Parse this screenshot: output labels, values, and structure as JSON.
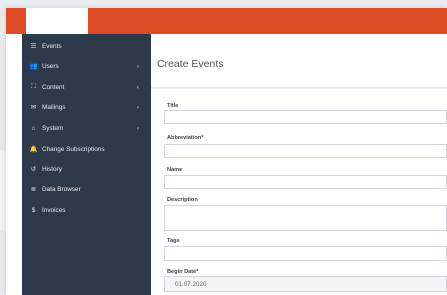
{
  "sidebar": {
    "items": [
      {
        "label": "Events",
        "icon": "list-icon",
        "glyph": "☰",
        "active": true,
        "chevron": ""
      },
      {
        "label": "Users",
        "icon": "users-icon",
        "glyph": "👥",
        "active": false,
        "chevron": "‹"
      },
      {
        "label": "Content",
        "icon": "sitemap-icon",
        "glyph": "⛶",
        "active": false,
        "chevron": "‹"
      },
      {
        "label": "Mailings",
        "icon": "envelope-icon",
        "glyph": "✉",
        "active": false,
        "chevron": "‹"
      },
      {
        "label": "System",
        "icon": "bank-icon",
        "glyph": "⌂",
        "active": false,
        "chevron": "‹"
      },
      {
        "label": "Change Subscriptions",
        "icon": "bell-icon",
        "glyph": "🔔",
        "active": false,
        "chevron": ""
      },
      {
        "label": "History",
        "icon": "history-icon",
        "glyph": "↺",
        "active": false,
        "chevron": ""
      },
      {
        "label": "Data Browser",
        "icon": "database-icon",
        "glyph": "≣",
        "active": false,
        "chevron": ""
      },
      {
        "label": "Invoices",
        "icon": "dollar-icon",
        "glyph": "$",
        "active": false,
        "chevron": ""
      }
    ]
  },
  "page": {
    "title": "Create Events"
  },
  "form": {
    "title_label": "Title",
    "title_value": "",
    "abbreviation_label": "Abbreviation*",
    "abbreviation_value": "",
    "name_label": "Name",
    "name_value": "",
    "description_label": "Description",
    "description_value": "",
    "tags_label": "Tags",
    "tags_value": "",
    "begin_date_label": "Begin Date*",
    "begin_date_value": "01.07.2020"
  },
  "colors": {
    "topbar": "#dd4b27",
    "sidebar": "#2c3a4a"
  }
}
